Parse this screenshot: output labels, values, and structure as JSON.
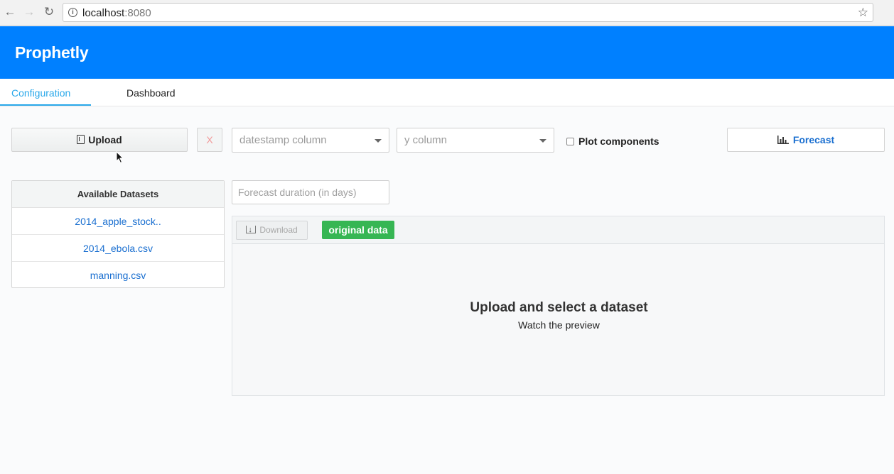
{
  "browser": {
    "url_host": "localhost",
    "url_port": ":8080",
    "back_icon": "back-arrow-icon",
    "forward_icon": "forward-arrow-icon",
    "reload_icon": "reload-icon",
    "star_icon": "bookmark-star-icon"
  },
  "app": {
    "brand": "Prophetly",
    "accent_color": "#0080ff"
  },
  "tabs": [
    {
      "label": "Configuration",
      "active": true
    },
    {
      "label": "Dashboard",
      "active": false
    }
  ],
  "toolbar": {
    "upload_label": "Upload",
    "clear_label": "X",
    "datestamp_placeholder": "datestamp column",
    "y_placeholder": "y column",
    "plot_components_label": "Plot components",
    "plot_components_checked": false,
    "forecast_label": "Forecast"
  },
  "datasets": {
    "header": "Available Datasets",
    "items": [
      "2014_apple_stock..",
      "2014_ebola.csv",
      "manning.csv"
    ]
  },
  "duration": {
    "placeholder": "Forecast duration (in days)"
  },
  "preview": {
    "download_label": "Download",
    "badge_label": "original data",
    "badge_color": "#36b653",
    "empty_title": "Upload and select a dataset",
    "empty_subtitle": "Watch the preview"
  }
}
